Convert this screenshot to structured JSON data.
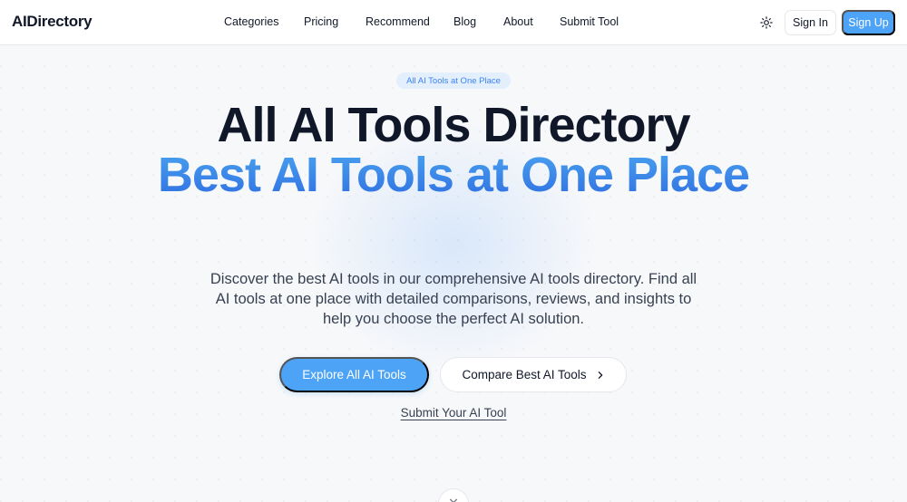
{
  "header": {
    "logo": "AIDirectory",
    "nav": [
      {
        "label": "Categories"
      },
      {
        "label": "Pricing"
      },
      {
        "label": "Recommend"
      },
      {
        "label": "Blog"
      },
      {
        "label": "About"
      },
      {
        "label": "Submit Tool"
      }
    ],
    "theme_icon": "sun-icon",
    "sign_in": "Sign In",
    "sign_up": "Sign Up"
  },
  "hero": {
    "badge": "All AI Tools at One Place",
    "title": "All AI Tools Directory",
    "subtitle": "Best AI Tools at One Place",
    "description": "Discover the best AI tools in our comprehensive AI tools directory. Find all AI tools at one place with detailed comparisons, reviews, and insights to help you choose the perfect AI solution.",
    "primary_button": "Explore All AI Tools",
    "secondary_button": "Compare Best AI Tools",
    "secondary_button_icon": "chevron-right-icon",
    "submit_link": "Submit Your AI Tool",
    "scroll_icon": "chevron-down-icon"
  },
  "colors": {
    "accent": "#4da3f5",
    "title": "#0f1729",
    "subtitle_gradient_top": "#4aa3ee",
    "subtitle_gradient_bottom": "#2f6fe0",
    "background": "#f7f8fa"
  }
}
